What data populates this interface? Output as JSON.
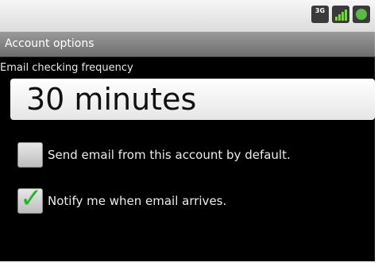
{
  "status_bar": {
    "network_label": "3G",
    "icons": [
      "3g-icon",
      "signal-icon",
      "battery-icon"
    ]
  },
  "title_bar": {
    "title": "Account options"
  },
  "section": {
    "header": "Email checking frequency",
    "frequency_value": "30 minutes"
  },
  "preferences": {
    "send_default": {
      "label": "Send email from this account by default.",
      "checked": false
    },
    "notify": {
      "label": "Notify me when email arrives.",
      "checked": true
    }
  },
  "colors": {
    "screen_background": "#000000",
    "check_green": "#23b62a",
    "title_bar": "#8a8a8a"
  }
}
